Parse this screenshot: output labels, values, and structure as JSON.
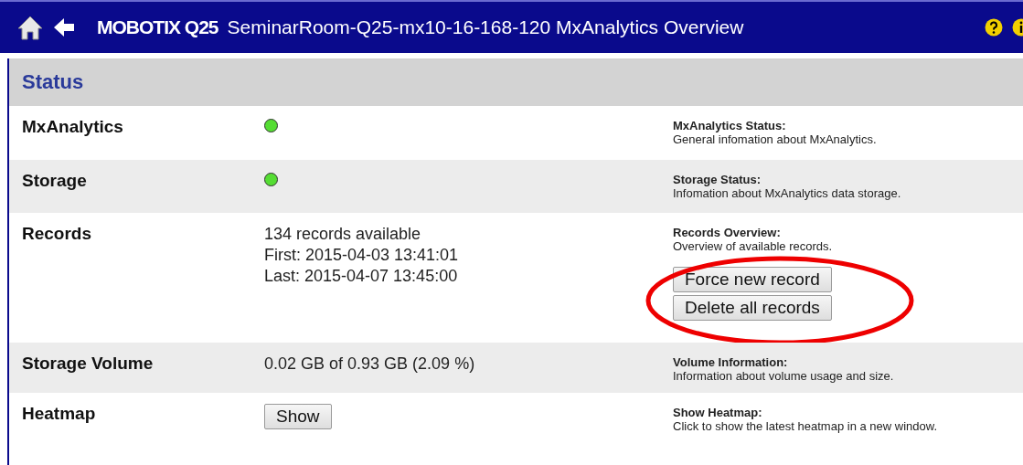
{
  "header": {
    "brand": "MOBOTIX Q25",
    "title": "SeminarRoom-Q25-mx10-16-168-120 MxAnalytics Overview"
  },
  "section": {
    "title": "Status"
  },
  "rows": [
    {
      "label": "MxAnalytics",
      "kind": "status",
      "ok": true,
      "help_title": "MxAnalytics Status:",
      "help_text": "General infomation about MxAnalytics."
    },
    {
      "label": "Storage",
      "kind": "status",
      "ok": true,
      "help_title": "Storage Status:",
      "help_text": "Infomation about MxAnalytics data storage."
    },
    {
      "label": "Records",
      "kind": "lines",
      "lines": [
        "134 records available",
        "First: 2015-04-03 13:41:01",
        "Last: 2015-04-07 13:45:00"
      ],
      "help_title": "Records Overview:",
      "help_text": "Overview of available records.",
      "help_buttons": [
        "Force new record",
        "Delete all records"
      ],
      "highlighted": true
    },
    {
      "label": "Storage Volume",
      "kind": "lines",
      "lines": [
        "0.02 GB of 0.93 GB (2.09 %)"
      ],
      "help_title": "Volume Information:",
      "help_text": "Information about volume usage and size."
    },
    {
      "label": "Heatmap",
      "kind": "button",
      "button": "Show",
      "help_title": "Show Heatmap:",
      "help_text": "Click to show the latest heatmap in a new window."
    }
  ]
}
